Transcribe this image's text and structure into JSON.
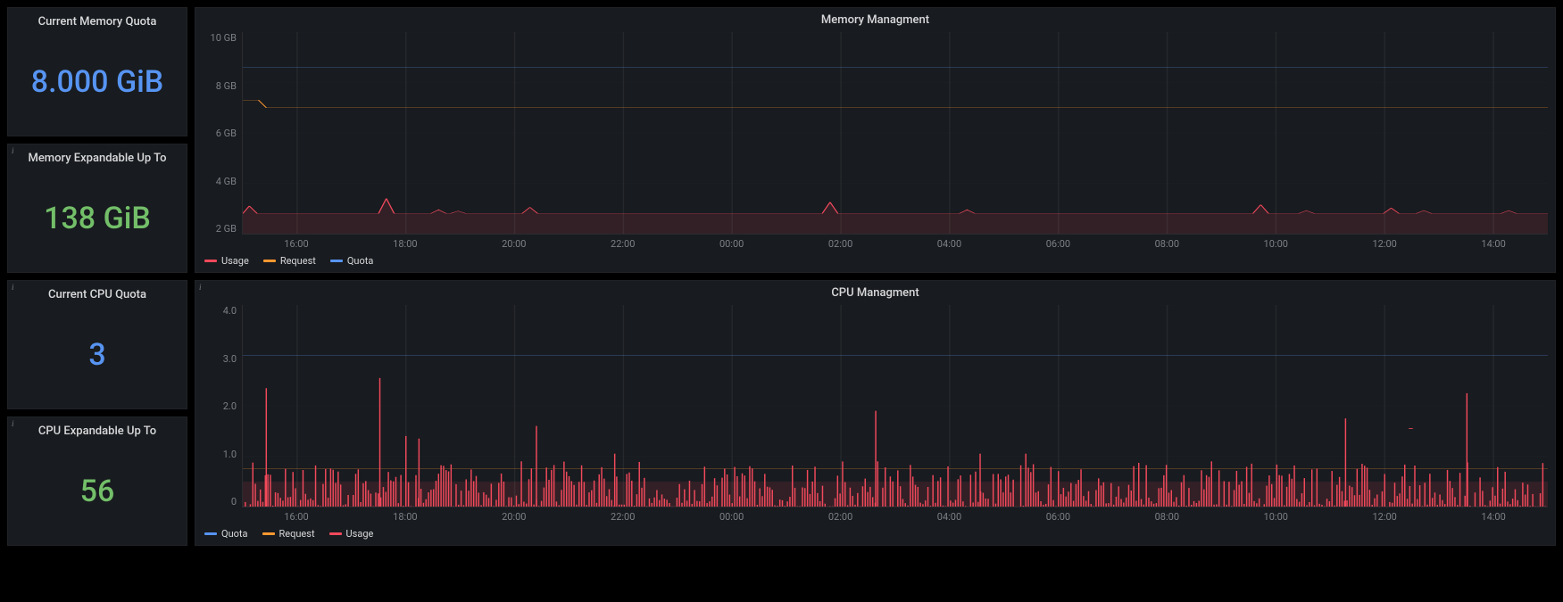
{
  "stats": {
    "mem_quota": {
      "title": "Current Memory Quota",
      "value": "8.000 GiB",
      "color": "blue"
    },
    "mem_expandable": {
      "title": "Memory Expandable Up To",
      "value": "138 GiB",
      "color": "green"
    },
    "cpu_quota": {
      "title": "Current CPU Quota",
      "value": "3",
      "color": "blue"
    },
    "cpu_expandable": {
      "title": "CPU Expandable Up To",
      "value": "56",
      "color": "green"
    }
  },
  "charts": {
    "memory": {
      "title": "Memory Managment",
      "legend": [
        "Usage",
        "Request",
        "Quota"
      ],
      "legend_colors": [
        "pink",
        "orange",
        "blue"
      ]
    },
    "cpu": {
      "title": "CPU Managment",
      "legend": [
        "Quota",
        "Request",
        "Usage"
      ],
      "legend_colors": [
        "blue",
        "orange",
        "pink"
      ]
    }
  },
  "chart_data": [
    {
      "id": "memory",
      "type": "line",
      "title": "Memory Managment",
      "xlabel": "",
      "ylabel": "",
      "ylim": [
        2,
        10
      ],
      "y_ticks": [
        "10 GB",
        "8 GB",
        "6 GB",
        "4 GB",
        "2 GB"
      ],
      "x_ticks": [
        "16:00",
        "18:00",
        "20:00",
        "22:00",
        "00:00",
        "02:00",
        "04:00",
        "06:00",
        "08:00",
        "10:00",
        "12:00",
        "14:00"
      ],
      "series": [
        {
          "name": "Quota",
          "color": "#5794f2",
          "constant": 8.6
        },
        {
          "name": "Request",
          "color": "#ff9830",
          "constant": 7.0,
          "start_value": 7.3
        },
        {
          "name": "Usage",
          "color": "#f2495c",
          "baseline": 2.8,
          "bumps": [
            {
              "x_frac": 0.005,
              "h": 0.3
            },
            {
              "x_frac": 0.11,
              "h": 0.6
            },
            {
              "x_frac": 0.15,
              "h": 0.15
            },
            {
              "x_frac": 0.165,
              "h": 0.1
            },
            {
              "x_frac": 0.22,
              "h": 0.25
            },
            {
              "x_frac": 0.45,
              "h": 0.45
            },
            {
              "x_frac": 0.555,
              "h": 0.15
            },
            {
              "x_frac": 0.78,
              "h": 0.35
            },
            {
              "x_frac": 0.815,
              "h": 0.12
            },
            {
              "x_frac": 0.88,
              "h": 0.22
            },
            {
              "x_frac": 0.905,
              "h": 0.12
            },
            {
              "x_frac": 0.97,
              "h": 0.12
            }
          ]
        }
      ]
    },
    {
      "id": "cpu",
      "type": "line",
      "title": "CPU Managment",
      "xlabel": "",
      "ylabel": "",
      "ylim": [
        0,
        4
      ],
      "y_ticks": [
        "4.0",
        "3.0",
        "2.0",
        "1.0",
        "0"
      ],
      "x_ticks": [
        "16:00",
        "18:00",
        "20:00",
        "22:00",
        "00:00",
        "02:00",
        "04:00",
        "06:00",
        "08:00",
        "10:00",
        "12:00",
        "14:00"
      ],
      "series": [
        {
          "name": "Quota",
          "color": "#5794f2",
          "constant": 3.0
        },
        {
          "name": "Request",
          "color": "#ff9830",
          "constant": 0.75
        },
        {
          "name": "Usage",
          "color": "#f2495c",
          "noisy_max": 0.9,
          "tall_spikes": [
            {
              "x_frac": 0.018,
              "val": 2.35
            },
            {
              "x_frac": 0.105,
              "val": 2.55
            },
            {
              "x_frac": 0.125,
              "val": 1.4
            },
            {
              "x_frac": 0.135,
              "val": 1.35
            },
            {
              "x_frac": 0.225,
              "val": 1.6
            },
            {
              "x_frac": 0.285,
              "val": 1.05
            },
            {
              "x_frac": 0.485,
              "val": 1.9
            },
            {
              "x_frac": 0.565,
              "val": 1.05
            },
            {
              "x_frac": 0.6,
              "val": 1.05
            },
            {
              "x_frac": 0.845,
              "val": 1.75
            },
            {
              "x_frac": 0.938,
              "val": 2.25
            }
          ],
          "dots": [
            {
              "x_frac": 0.895,
              "val": 1.55
            }
          ]
        }
      ]
    }
  ]
}
